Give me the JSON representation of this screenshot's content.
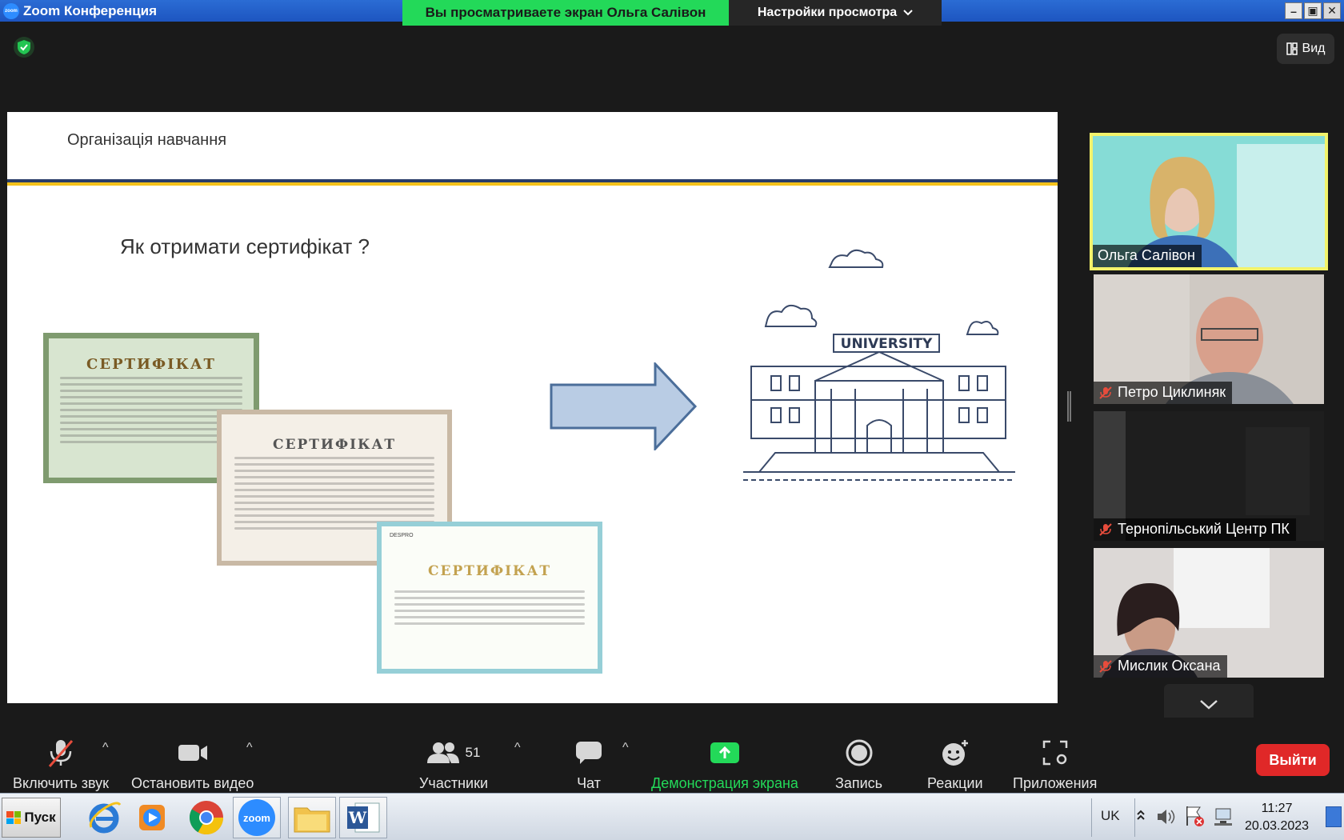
{
  "window": {
    "title": "Zoom Конференция",
    "share_banner": "Вы просматриваете экран Ольга Салівон",
    "view_settings": "Настройки просмотра",
    "view_button": "Вид"
  },
  "slide": {
    "header": "Організація навчання",
    "heading": "Як отримати сертифікат ?",
    "certificates": [
      {
        "title": "СЕРТИФІКАТ"
      },
      {
        "title": "СЕРТИФІКАТ"
      },
      {
        "title": "СЕРТИФІКАТ",
        "tag": "DESPRO"
      }
    ],
    "university_sign": "UNIVERSITY"
  },
  "participants": [
    {
      "name": "Ольга Салівон",
      "muted": false,
      "active": true,
      "bg": "#7fd9d6"
    },
    {
      "name": "Петро Циклиняк",
      "muted": true,
      "active": false,
      "bg": "#c9c2bb"
    },
    {
      "name": "Тернопільський Центр ПК",
      "muted": true,
      "active": false,
      "bg": "#1e1e1e"
    },
    {
      "name": "Мислик Оксана",
      "muted": true,
      "active": false,
      "bg": "#d8d4d2"
    }
  ],
  "toolbar": {
    "audio": "Включить звук",
    "video": "Остановить видео",
    "participants": "Участники",
    "participants_count": "51",
    "chat": "Чат",
    "share": "Демонстрация экрана",
    "record": "Запись",
    "reactions": "Реакции",
    "apps": "Приложения",
    "leave": "Выйти"
  },
  "taskbar": {
    "start": "Пуск",
    "lang": "UK",
    "time": "11:27",
    "date": "20.03.2023",
    "zoom_label": "zoom"
  },
  "colors": {
    "share_green": "#23d959",
    "leave_red": "#e02828",
    "active_speaker": "#f2f36b"
  }
}
